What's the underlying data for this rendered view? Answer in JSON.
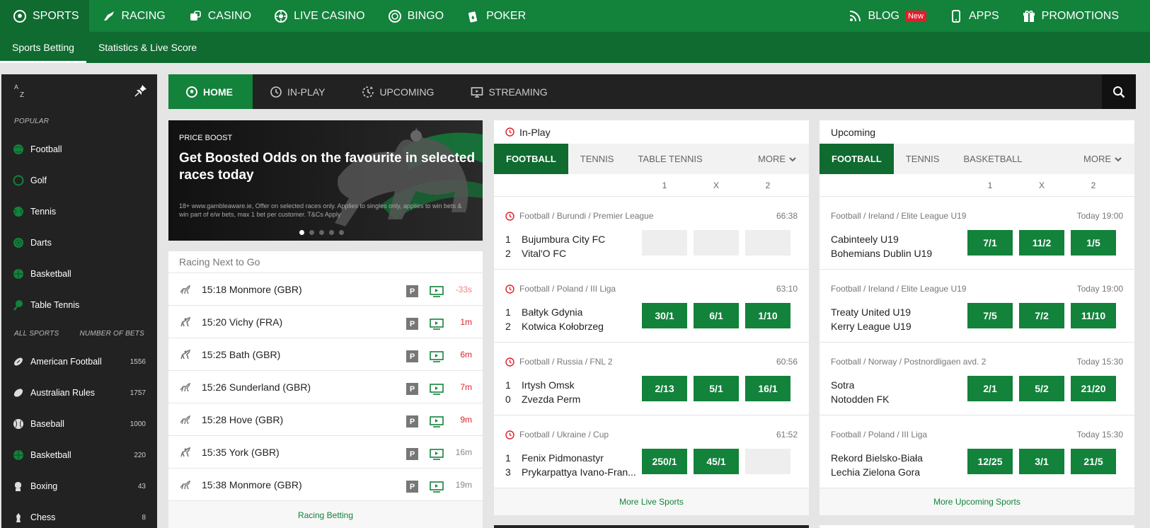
{
  "top_nav": {
    "left": [
      {
        "label": "SPORTS",
        "icon": "soccer-ball-icon"
      },
      {
        "label": "RACING",
        "icon": "horse-icon"
      },
      {
        "label": "CASINO",
        "icon": "dice-icon"
      },
      {
        "label": "LIVE CASINO",
        "icon": "roulette-icon"
      },
      {
        "label": "BINGO",
        "icon": "bingo-ball-icon"
      },
      {
        "label": "POKER",
        "icon": "cards-icon"
      }
    ],
    "right": [
      {
        "label": "BLOG",
        "icon": "rss-icon",
        "badge": "New"
      },
      {
        "label": "APPS",
        "icon": "phone-icon"
      },
      {
        "label": "PROMOTIONS",
        "icon": "gift-icon"
      }
    ]
  },
  "sub_nav": [
    "Sports Betting",
    "Statistics & Live Score"
  ],
  "sidebar": {
    "popular_label": "POPULAR",
    "popular": [
      {
        "label": "Football",
        "icon": "football-icon"
      },
      {
        "label": "Golf",
        "icon": "golf-icon"
      },
      {
        "label": "Tennis",
        "icon": "tennis-icon"
      },
      {
        "label": "Darts",
        "icon": "darts-icon"
      },
      {
        "label": "Basketball",
        "icon": "basketball-icon"
      },
      {
        "label": "Table Tennis",
        "icon": "table-tennis-icon"
      }
    ],
    "all_label": "ALL SPORTS",
    "count_label": "NUMBER OF BETS",
    "all": [
      {
        "label": "American Football",
        "count": "1556",
        "icon": "american-football-icon"
      },
      {
        "label": "Australian Rules",
        "count": "1757",
        "icon": "australian-rules-icon"
      },
      {
        "label": "Baseball",
        "count": "1000",
        "icon": "baseball-icon"
      },
      {
        "label": "Basketball",
        "count": "220",
        "icon": "basketball-icon"
      },
      {
        "label": "Boxing",
        "count": "43",
        "icon": "boxing-icon"
      },
      {
        "label": "Chess",
        "count": "8",
        "icon": "chess-icon"
      }
    ]
  },
  "tabs": [
    {
      "label": "HOME",
      "icon": "home-icon"
    },
    {
      "label": "IN-PLAY",
      "icon": "clock-icon"
    },
    {
      "label": "UPCOMING",
      "icon": "upcoming-icon"
    },
    {
      "label": "STREAMING",
      "icon": "monitor-icon"
    }
  ],
  "promo": {
    "label": "PRICE BOOST",
    "title": "Get Boosted Odds on the favourite in selected races today",
    "terms": "18+ www.gambleaware.ie, Offer on selected races only. Applies to singles only, applies to win bets & win part of e/w bets, max 1 bet per customer. T&Cs Apply",
    "slides": 5,
    "active_slide": 1
  },
  "racing": {
    "title": "Racing Next to Go",
    "races": [
      {
        "name": "15:18 Monmore (GBR)",
        "time": "-33s",
        "type": "greyhound"
      },
      {
        "name": "15:20 Vichy (FRA)",
        "time": "1m",
        "type": "horse"
      },
      {
        "name": "15:25 Bath (GBR)",
        "time": "6m",
        "type": "horse"
      },
      {
        "name": "15:26 Sunderland (GBR)",
        "time": "7m",
        "type": "greyhound"
      },
      {
        "name": "15:28 Hove (GBR)",
        "time": "9m",
        "type": "greyhound"
      },
      {
        "name": "15:35 York (GBR)",
        "time": "16m",
        "type": "horse"
      },
      {
        "name": "15:38 Monmore (GBR)",
        "time": "19m",
        "type": "greyhound"
      }
    ],
    "p_label": "P",
    "footer": "Racing Betting"
  },
  "inplay": {
    "title": "In-Play",
    "tabs": [
      "FOOTBALL",
      "TENNIS",
      "TABLE TENNIS"
    ],
    "more": "MORE",
    "cols": [
      "1",
      "X",
      "2"
    ],
    "matches": [
      {
        "league": "Football / Burundi / Premier League",
        "time": "66:38",
        "s1": "1",
        "t1": "Bujumbura City FC",
        "s2": "2",
        "t2": "Vital'O FC",
        "odds": [
          "",
          "",
          ""
        ]
      },
      {
        "league": "Football / Poland / III Liga",
        "time": "63:10",
        "s1": "1",
        "t1": "Bałtyk Gdynia",
        "s2": "2",
        "t2": "Kotwica Kołobrzeg",
        "odds": [
          "30/1",
          "6/1",
          "1/10"
        ]
      },
      {
        "league": "Football / Russia / FNL 2",
        "time": "60:56",
        "s1": "1",
        "t1": "Irtysh Omsk",
        "s2": "0",
        "t2": "Zvezda Perm",
        "odds": [
          "2/13",
          "5/1",
          "16/1"
        ]
      },
      {
        "league": "Football / Ukraine / Cup",
        "time": "61:52",
        "s1": "1",
        "t1": "Fenix Pidmonastyr",
        "s2": "3",
        "t2": "Prykarpattya Ivano-Fran...",
        "odds": [
          "250/1",
          "45/1",
          ""
        ]
      }
    ],
    "footer": "More Live Sports"
  },
  "upcoming": {
    "title": "Upcoming",
    "tabs": [
      "FOOTBALL",
      "TENNIS",
      "BASKETBALL"
    ],
    "more": "MORE",
    "cols": [
      "1",
      "X",
      "2"
    ],
    "matches": [
      {
        "league": "Football / Ireland / Elite League U19",
        "time": "Today 19:00",
        "t1": "Cabinteely U19",
        "t2": "Bohemians Dublin U19",
        "odds": [
          "7/1",
          "11/2",
          "1/5"
        ]
      },
      {
        "league": "Football / Ireland / Elite League U19",
        "time": "Today 19:00",
        "t1": "Treaty United U19",
        "t2": "Kerry League U19",
        "odds": [
          "7/5",
          "7/2",
          "11/10"
        ]
      },
      {
        "league": "Football / Norway / Postnordligaen avd. 2",
        "time": "Today 15:30",
        "t1": "Sotra",
        "t2": "Notodden FK",
        "odds": [
          "2/1",
          "5/2",
          "21/20"
        ]
      },
      {
        "league": "Football / Poland / III Liga",
        "time": "Today 15:30",
        "t1": "Rekord Bielsko-Biała",
        "t2": "Lechia Zielona Gora",
        "odds": [
          "12/25",
          "3/1",
          "21/5"
        ]
      }
    ],
    "footer": "More Upcoming Sports"
  },
  "colors": {
    "primary": "#13823b",
    "dark_green": "#0f6b30",
    "sidebar": "#222222",
    "live_red": "#e31d2b"
  }
}
